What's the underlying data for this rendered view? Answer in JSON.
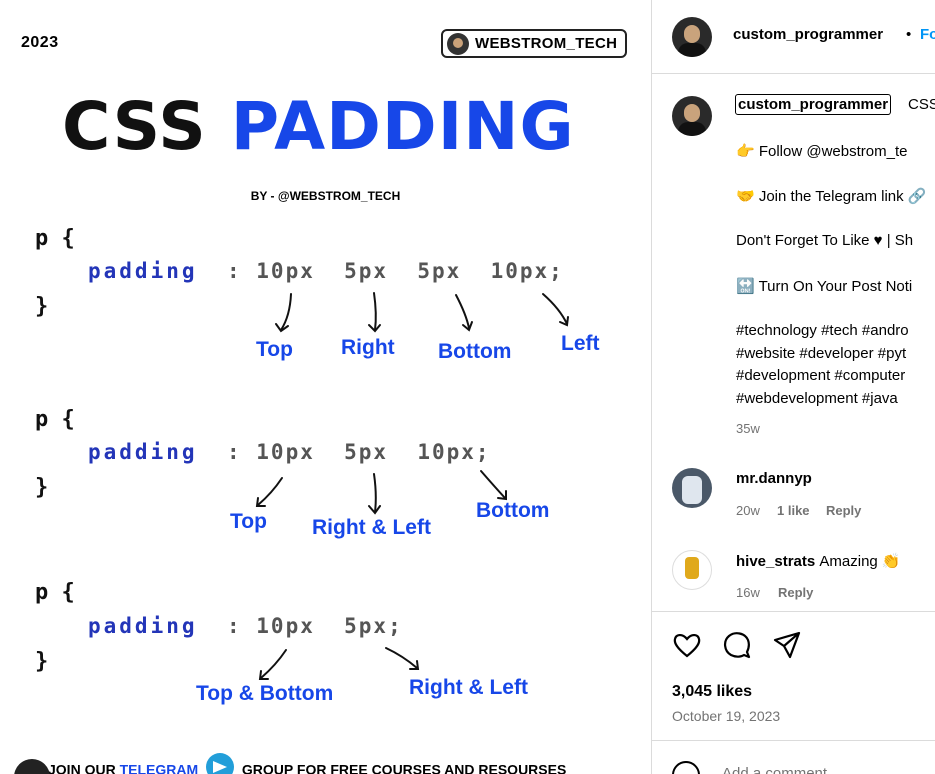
{
  "post_image": {
    "year": "2023",
    "brand": "WEBSTROM_TECH",
    "title_word1": "CSS",
    "title_word2": "PADDING",
    "byline": "BY - @WEBSTROM_TECH",
    "blocks": [
      {
        "selector_open": "p {",
        "property": "padding",
        "values": ": 10px  5px  5px  10px;",
        "selector_close": "}",
        "labels": [
          "Top",
          "Right",
          "Bottom",
          "Left"
        ]
      },
      {
        "selector_open": "p {",
        "property": "padding",
        "values": ": 10px  5px  10px;",
        "selector_close": "}",
        "labels": [
          "Top",
          "Right & Left",
          "Bottom"
        ]
      },
      {
        "selector_open": "p {",
        "property": "padding",
        "values": ": 10px  5px;",
        "selector_close": "}",
        "labels": [
          "Top & Bottom",
          "Right & Left"
        ]
      }
    ],
    "footer": {
      "join": "JOIN OUR",
      "telegram": "TELEGRAM",
      "rest": "GROUP FOR FREE COURSES AND RESOURSES"
    },
    "accent": "#1747e8"
  },
  "panel": {
    "header": {
      "username": "custom_programmer",
      "separator": "•",
      "follow": "Fo"
    },
    "caption": {
      "username": "custom_programmer",
      "text": "CSS",
      "lines": [
        "👉 Follow @webstrom_te",
        "🤝 Join the Telegram link 🔗",
        "Don't Forget To Like ♥ | Sh",
        "🔛 Turn On Your Post Noti",
        "#technology #tech #andro",
        "#website #developer #pyt",
        "#development #computer",
        "#webdevelopment #java"
      ],
      "age": "35w"
    },
    "comments": [
      {
        "username": "mr.dannyp",
        "text": "",
        "age": "20w",
        "likes": "1 like",
        "reply": "Reply"
      },
      {
        "username": "hive_strats",
        "text": "Amazing 👏",
        "age": "16w",
        "likes": "",
        "reply": "Reply"
      }
    ],
    "likes": "3,045 likes",
    "date": "October 19, 2023",
    "add_comment": "Add a comment…",
    "link_color": "#0095f6"
  }
}
